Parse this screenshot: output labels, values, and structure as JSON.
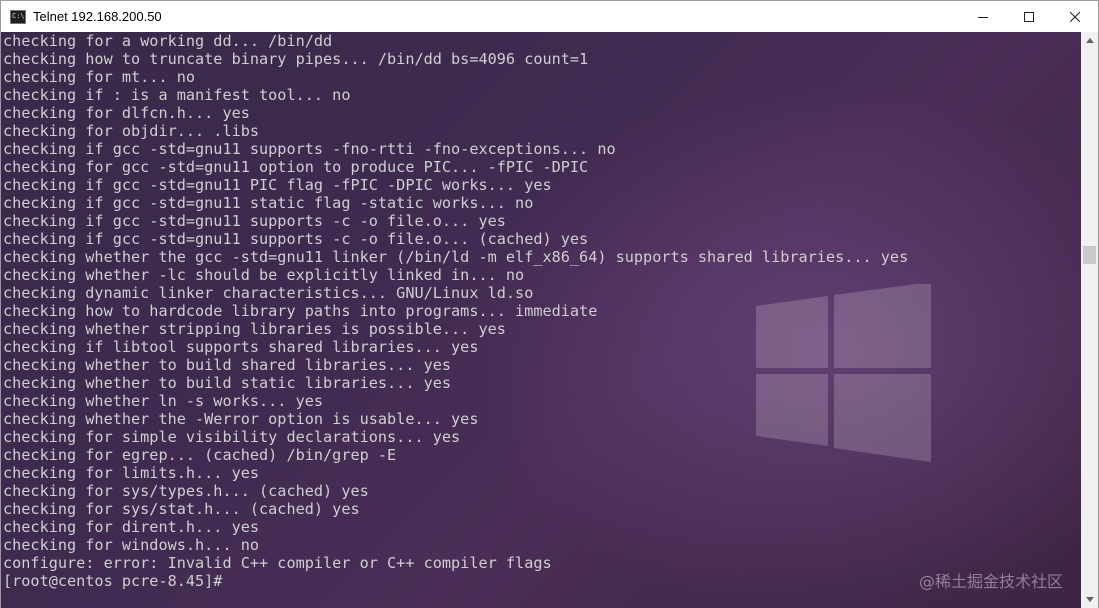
{
  "window": {
    "title": "Telnet 192.168.200.50"
  },
  "terminal": {
    "lines": [
      "checking for a working dd... /bin/dd",
      "checking how to truncate binary pipes... /bin/dd bs=4096 count=1",
      "checking for mt... no",
      "checking if : is a manifest tool... no",
      "checking for dlfcn.h... yes",
      "checking for objdir... .libs",
      "checking if gcc -std=gnu11 supports -fno-rtti -fno-exceptions... no",
      "checking for gcc -std=gnu11 option to produce PIC... -fPIC -DPIC",
      "checking if gcc -std=gnu11 PIC flag -fPIC -DPIC works... yes",
      "checking if gcc -std=gnu11 static flag -static works... no",
      "checking if gcc -std=gnu11 supports -c -o file.o... yes",
      "checking if gcc -std=gnu11 supports -c -o file.o... (cached) yes",
      "checking whether the gcc -std=gnu11 linker (/bin/ld -m elf_x86_64) supports shared libraries... yes",
      "checking whether -lc should be explicitly linked in... no",
      "checking dynamic linker characteristics... GNU/Linux ld.so",
      "checking how to hardcode library paths into programs... immediate",
      "checking whether stripping libraries is possible... yes",
      "checking if libtool supports shared libraries... yes",
      "checking whether to build shared libraries... yes",
      "checking whether to build static libraries... yes",
      "checking whether ln -s works... yes",
      "checking whether the -Werror option is usable... yes",
      "checking for simple visibility declarations... yes",
      "checking for egrep... (cached) /bin/grep -E",
      "checking for limits.h... yes",
      "checking for sys/types.h... (cached) yes",
      "checking for sys/stat.h... (cached) yes",
      "checking for dirent.h... yes",
      "checking for windows.h... no",
      "configure: error: Invalid C++ compiler or C++ compiler flags"
    ],
    "prompt": "[root@centos pcre-8.45]#"
  },
  "watermark": "@稀土掘金技术社区",
  "icons": {
    "app": "console-icon",
    "minimize": "minimize-icon",
    "maximize": "maximize-icon",
    "close": "close-icon",
    "scroll_up": "scroll-up-arrow-icon",
    "scroll_down": "scroll-down-arrow-icon"
  },
  "colors": {
    "terminal_text": "#cfcfcf",
    "terminal_bg": "#3f2a50"
  }
}
